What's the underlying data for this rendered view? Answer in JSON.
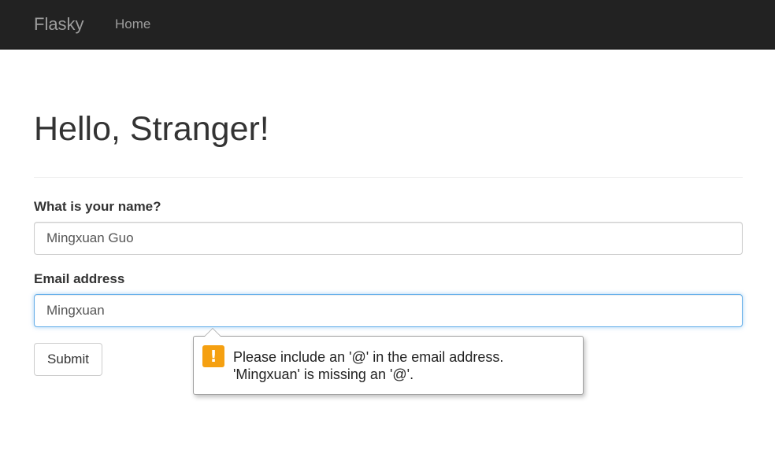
{
  "navbar": {
    "brand": "Flasky",
    "items": [
      {
        "label": "Home"
      }
    ]
  },
  "main": {
    "title": "Hello, Stranger!",
    "form": {
      "name_label": "What is your name?",
      "name_value": "Mingxuan Guo",
      "email_label": "Email address",
      "email_value": "Mingxuan",
      "submit_label": "Submit"
    }
  },
  "validation_tooltip": {
    "icon": "warning-icon",
    "icon_color": "#f5a011",
    "line1": "Please include an '@' in the email address.",
    "line2": "'Mingxuan' is missing an '@'."
  }
}
